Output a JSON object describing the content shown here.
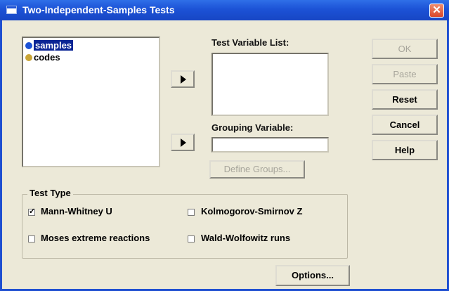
{
  "window": {
    "title": "Two-Independent-Samples Tests",
    "close_glyph": "✕"
  },
  "variables": [
    {
      "label": "samples",
      "selected": true
    },
    {
      "label": "codes",
      "selected": false
    }
  ],
  "test_variable_list": {
    "label": "Test Variable List:"
  },
  "grouping_variable": {
    "label": "Grouping Variable:",
    "value": ""
  },
  "buttons": {
    "ok": "OK",
    "paste": "Paste",
    "reset": "Reset",
    "cancel": "Cancel",
    "help": "Help",
    "define_groups": "Define Groups...",
    "options": "Options..."
  },
  "test_type": {
    "legend": "Test Type",
    "mann_whitney": {
      "label": "Mann-Whitney U",
      "checked": true
    },
    "kolmogorov": {
      "label": "Kolmogorov-Smirnov Z",
      "checked": false
    },
    "moses": {
      "label": "Moses extreme reactions",
      "checked": false
    },
    "wald": {
      "label": "Wald-Wolfowitz runs",
      "checked": false
    }
  }
}
